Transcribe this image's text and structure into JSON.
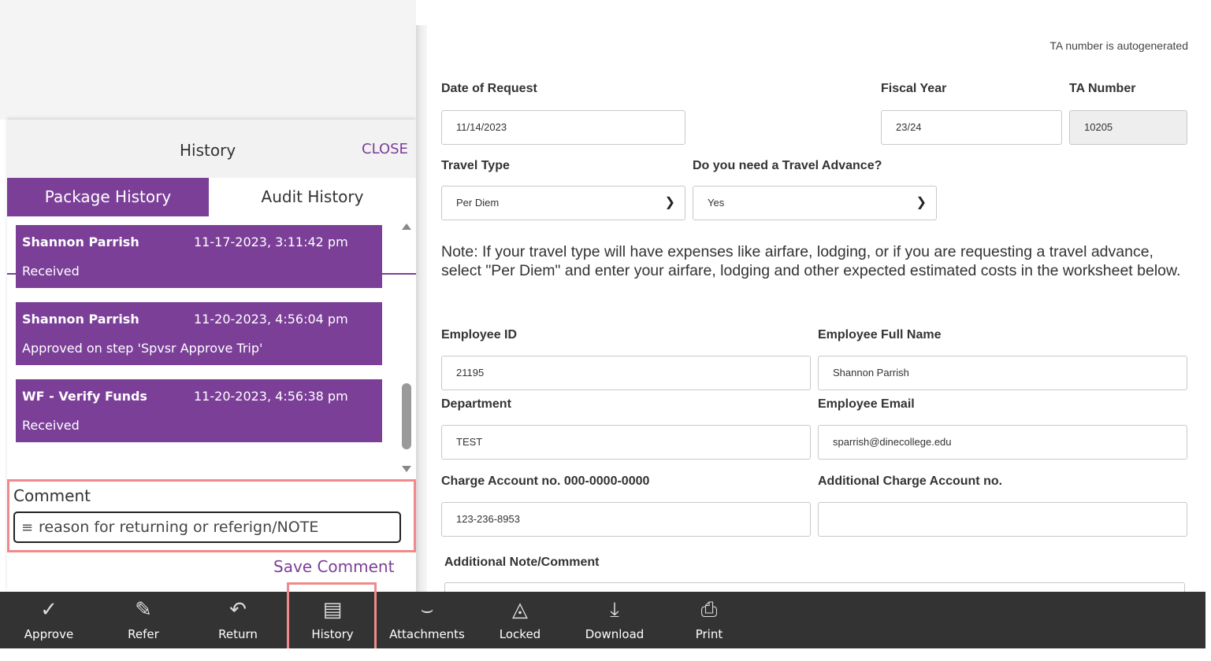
{
  "history": {
    "title": "History",
    "close_label": "CLOSE",
    "tabs": [
      "Package History",
      "Audit History"
    ],
    "entries": [
      {
        "who": "Shannon Parrish",
        "when": "11-17-2023, 3:11:42 pm",
        "what": "Received"
      },
      {
        "who": "Shannon Parrish",
        "when": "11-20-2023, 4:56:04 pm",
        "what": "Approved on step 'Spvsr Approve Trip'"
      },
      {
        "who": "WF - Verify Funds",
        "when": "11-20-2023, 4:56:38 pm",
        "what": "Received"
      }
    ],
    "comment_label": "Comment",
    "comment_value": "reason for returning or referign/NOTE",
    "save_label": "Save Comment"
  },
  "form": {
    "autogen_note": "TA number is autogenerated",
    "date_of_request": {
      "label": "Date of Request",
      "value": "11/14/2023"
    },
    "fiscal_year": {
      "label": "Fiscal Year",
      "value": "23/24"
    },
    "ta_number": {
      "label": "TA Number",
      "value": "10205"
    },
    "travel_type": {
      "label": "Travel Type",
      "value": "Per Diem"
    },
    "travel_advance": {
      "label": "Do you need a Travel Advance?",
      "value": "Yes"
    },
    "note": "Note: If your travel type will have expenses like airfare, lodging, or if you are requesting a travel advance, select \"Per Diem\" and enter your airfare, lodging and other expected estimated costs in the worksheet below.",
    "employee_id": {
      "label": "Employee ID",
      "value": "21195"
    },
    "employee_name": {
      "label": "Employee Full Name",
      "value": "Shannon Parrish"
    },
    "department": {
      "label": "Department",
      "value": "TEST"
    },
    "employee_email": {
      "label": "Employee Email",
      "value": "sparrish@dinecollege.edu"
    },
    "charge_account": {
      "label": "Charge Account no. 000-0000-0000",
      "value": "123-236-8953"
    },
    "addl_charge_account": {
      "label": "Additional Charge Account no.",
      "value": ""
    },
    "addl_note": {
      "label": "Additional Note/Comment"
    }
  },
  "toolbar": {
    "items": [
      {
        "label": "Approve",
        "icon": "check-icon"
      },
      {
        "label": "Refer",
        "icon": "refer-icon"
      },
      {
        "label": "Return",
        "icon": "return-icon"
      },
      {
        "label": "History",
        "icon": "history-icon"
      },
      {
        "label": "Attachments",
        "icon": "paperclip-icon"
      },
      {
        "label": "Locked",
        "icon": "lock-icon"
      },
      {
        "label": "Download",
        "icon": "download-icon"
      },
      {
        "label": "Print",
        "icon": "printer-icon"
      }
    ]
  },
  "colors": {
    "accent": "#7b3f98",
    "toolbar_bg": "#333333",
    "highlight": "#f08a8a"
  }
}
